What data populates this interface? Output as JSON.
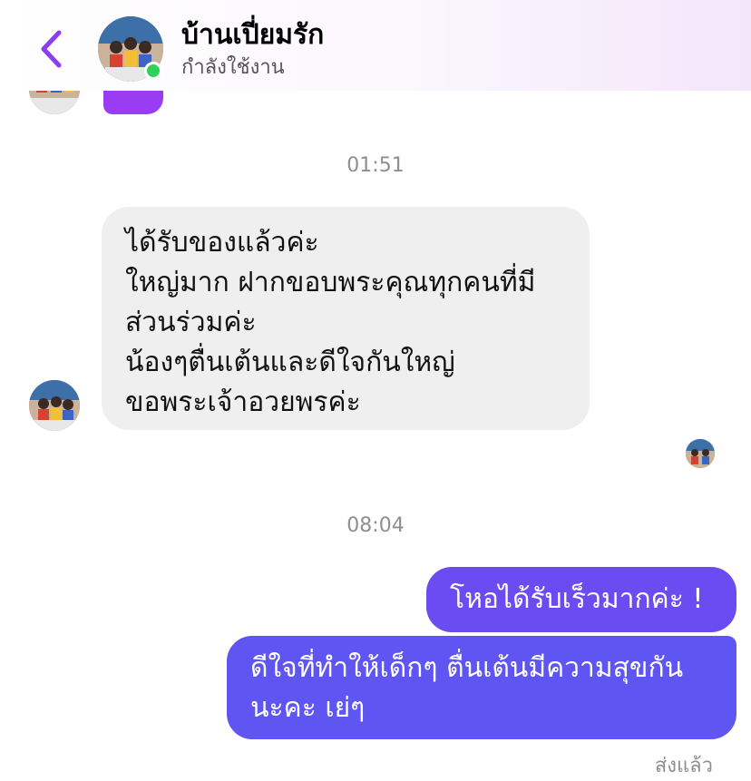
{
  "header": {
    "back_icon": "chevron-left-icon",
    "name": "บ้านเปี่ยมรัก",
    "status": "กำลังใช้งาน",
    "online_color": "#2fd158",
    "accent_color": "#8b3cf5"
  },
  "messages": {
    "time_1": "01:51",
    "incoming": [
      "ได้รับของแล้วค่ะ",
      "ใหญ่มาก ฝากขอบพระคุณทุกคนที่มี",
      "ส่วนร่วมค่ะ",
      "น้องๆตื่นเต้นและดีใจกันใหญ่",
      "ขอพระเจ้าอวยพรค่ะ"
    ],
    "time_2": "08:04",
    "outgoing_1": "โหอได้รับเร็วมากค่ะ !",
    "outgoing_2": [
      "ดีใจที่ทำให้เด็กๆ ตื่นเต้นมีความสุขกัน",
      "นะคะ เย่ๆ"
    ],
    "sent_status": "ส่งแล้ว"
  }
}
